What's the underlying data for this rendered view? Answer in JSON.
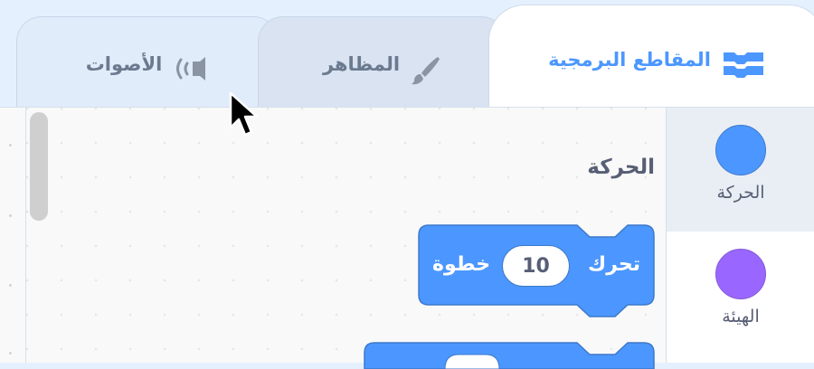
{
  "tabs": [
    {
      "id": "sounds",
      "label": "الأصوات",
      "icon": "speaker-icon"
    },
    {
      "id": "costumes",
      "label": "المظاهر",
      "icon": "paintbrush-icon"
    },
    {
      "id": "code",
      "label": "المقاطع البرمجية",
      "icon": "code-blocks-icon",
      "selected": true
    }
  ],
  "palette": {
    "section_title": "الحركة",
    "blocks": [
      {
        "prefix": "تحرك",
        "input_value": "10",
        "suffix": "خطوة"
      }
    ]
  },
  "categories": [
    {
      "label": "الحركة",
      "color": "#4c97ff",
      "selected": true
    },
    {
      "label": "الهيئة",
      "color": "#9966ff",
      "selected": false
    }
  ],
  "colors": {
    "accent": "#4c97ff",
    "motion": "#4c97ff",
    "looks": "#9966ff",
    "tab_inactive_text": "#6b7a8f"
  }
}
